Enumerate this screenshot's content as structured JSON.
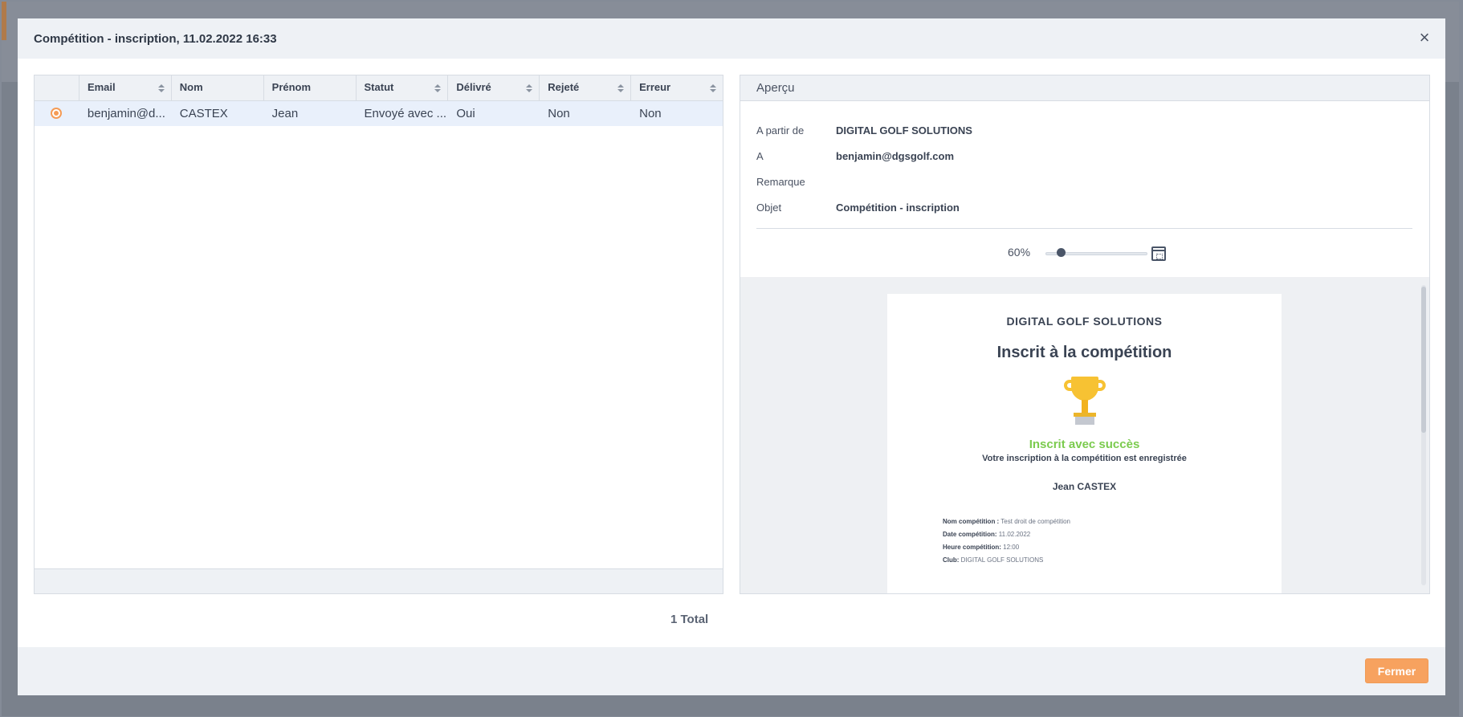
{
  "modal": {
    "title": "Compétition - inscription, 11.02.2022 16:33",
    "close_icon": "close-icon",
    "footer_button": "Fermer"
  },
  "grid": {
    "columns": [
      "Email",
      "Nom",
      "Prénom",
      "Statut",
      "Délivré",
      "Rejeté",
      "Erreur"
    ],
    "rows": [
      {
        "email": "benjamin@d...",
        "nom": "CASTEX",
        "prenom": "Jean",
        "statut": "Envoyé avec ...",
        "delivre": "Oui",
        "rejete": "Non",
        "erreur": "Non"
      }
    ],
    "total": "1 Total"
  },
  "preview": {
    "title": "Aperçu",
    "meta": [
      {
        "label": "A partir de",
        "value": "DIGITAL GOLF SOLUTIONS"
      },
      {
        "label": "A",
        "value": "benjamin@dgsgolf.com"
      },
      {
        "label": "Remarque",
        "value": ""
      },
      {
        "label": "Objet",
        "value": "Compétition - inscription"
      }
    ],
    "zoom": "60%",
    "zoom_level": 0.12
  },
  "email": {
    "org": "DIGITAL GOLF SOLUTIONS",
    "title": "Inscrit à la compétition",
    "success": "Inscrit avec succès",
    "subtitle": "Votre inscription à la compétition est enregistrée",
    "name": "Jean CASTEX",
    "details": [
      {
        "label": "Nom compétition :",
        "value": "Test droit de compétition"
      },
      {
        "label": "Date compétition:",
        "value": "11.02.2022"
      },
      {
        "label": "Heure compétition:",
        "value": "12:00"
      },
      {
        "label": "Club:",
        "value": "DIGITAL GOLF SOLUTIONS"
      }
    ]
  },
  "colors": {
    "accent": "#f7a25f",
    "success": "#7bcb4e",
    "trophy": "#f7c233"
  }
}
